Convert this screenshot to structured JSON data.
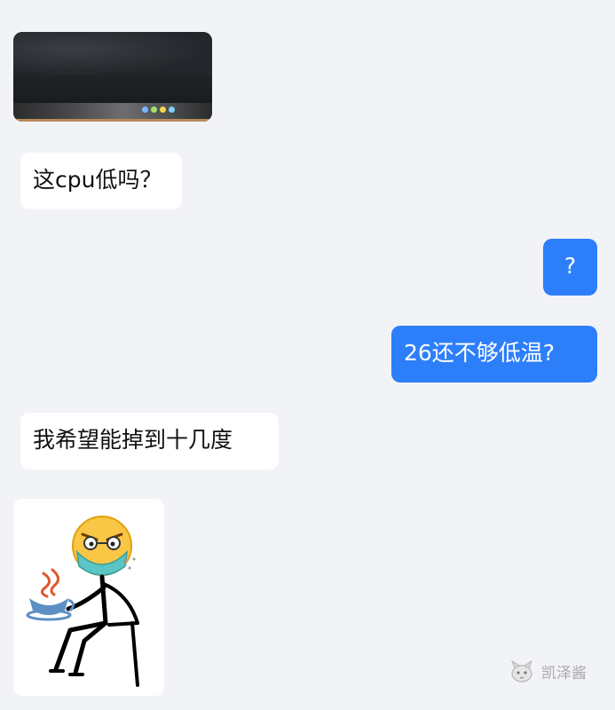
{
  "messages": [
    {
      "kind": "image",
      "side": "left",
      "description": "monitor-photo"
    },
    {
      "kind": "text",
      "side": "left",
      "text": "这cpu低吗？"
    },
    {
      "kind": "text",
      "side": "right",
      "text": "?"
    },
    {
      "kind": "text",
      "side": "right",
      "text": "26还不够低温?"
    },
    {
      "kind": "text",
      "side": "left",
      "text": "我希望能掉到十几度"
    },
    {
      "kind": "sticker",
      "side": "left",
      "description": "meme-sticker"
    }
  ],
  "watermark": {
    "text": "凯泽酱",
    "icon": "fox-avatar-icon"
  },
  "colors": {
    "background": "#f2f3f7",
    "incoming_bubble": "#ffffff",
    "outgoing_bubble": "#2d7ff9",
    "outgoing_text": "#ffffff",
    "incoming_text": "#111111"
  }
}
